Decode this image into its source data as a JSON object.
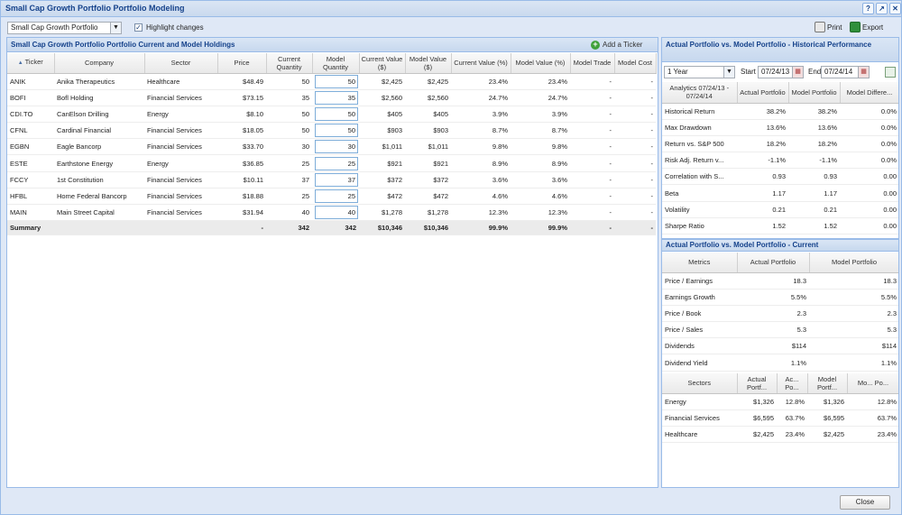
{
  "window": {
    "title": "Small Cap Growth Portfolio Portfolio Modeling"
  },
  "toolbar": {
    "portfolio_select": "Small Cap Growth Portfolio",
    "highlight_label": "Highlight changes",
    "highlight_checked": true,
    "print_label": "Print",
    "export_label": "Export"
  },
  "holdings": {
    "title": "Small Cap Growth Portfolio Portfolio Current and Model Holdings",
    "add_ticker_label": "Add a Ticker",
    "columns": [
      "Ticker",
      "Company",
      "Sector",
      "Price",
      "Current Quantity",
      "Model Quantity",
      "Current Value ($)",
      "Model Value ($)",
      "Current Value (%)",
      "Model Value (%)",
      "Model Trade",
      "Model Cost"
    ],
    "sort_indicator": "▲",
    "rows": [
      {
        "ticker": "ANIK",
        "company": "Anika Therapeutics",
        "sector": "Healthcare",
        "price": "$48.49",
        "cur_qty": "50",
        "model_qty": "50",
        "cur_val": "$2,425",
        "model_val": "$2,425",
        "cur_pct": "23.4%",
        "model_pct": "23.4%",
        "trade": "-",
        "cost": "-"
      },
      {
        "ticker": "BOFI",
        "company": "Bofl Holding",
        "sector": "Financial Services",
        "price": "$73.15",
        "cur_qty": "35",
        "model_qty": "35",
        "cur_val": "$2,560",
        "model_val": "$2,560",
        "cur_pct": "24.7%",
        "model_pct": "24.7%",
        "trade": "-",
        "cost": "-"
      },
      {
        "ticker": "CDI.TO",
        "company": "CanElson Drilling",
        "sector": "Energy",
        "price": "$8.10",
        "cur_qty": "50",
        "model_qty": "50",
        "cur_val": "$405",
        "model_val": "$405",
        "cur_pct": "3.9%",
        "model_pct": "3.9%",
        "trade": "-",
        "cost": "-"
      },
      {
        "ticker": "CFNL",
        "company": "Cardinal Financial",
        "sector": "Financial Services",
        "price": "$18.05",
        "cur_qty": "50",
        "model_qty": "50",
        "cur_val": "$903",
        "model_val": "$903",
        "cur_pct": "8.7%",
        "model_pct": "8.7%",
        "trade": "-",
        "cost": "-"
      },
      {
        "ticker": "EGBN",
        "company": "Eagle Bancorp",
        "sector": "Financial Services",
        "price": "$33.70",
        "cur_qty": "30",
        "model_qty": "30",
        "cur_val": "$1,011",
        "model_val": "$1,011",
        "cur_pct": "9.8%",
        "model_pct": "9.8%",
        "trade": "-",
        "cost": "-"
      },
      {
        "ticker": "ESTE",
        "company": "Earthstone Energy",
        "sector": "Energy",
        "price": "$36.85",
        "cur_qty": "25",
        "model_qty": "25",
        "cur_val": "$921",
        "model_val": "$921",
        "cur_pct": "8.9%",
        "model_pct": "8.9%",
        "trade": "-",
        "cost": "-"
      },
      {
        "ticker": "FCCY",
        "company": "1st Constitution",
        "sector": "Financial Services",
        "price": "$10.11",
        "cur_qty": "37",
        "model_qty": "37",
        "cur_val": "$372",
        "model_val": "$372",
        "cur_pct": "3.6%",
        "model_pct": "3.6%",
        "trade": "-",
        "cost": "-"
      },
      {
        "ticker": "HFBL",
        "company": "Home Federal Bancorp",
        "sector": "Financial Services",
        "price": "$18.88",
        "cur_qty": "25",
        "model_qty": "25",
        "cur_val": "$472",
        "model_val": "$472",
        "cur_pct": "4.6%",
        "model_pct": "4.6%",
        "trade": "-",
        "cost": "-"
      },
      {
        "ticker": "MAIN",
        "company": "Main Street Capital",
        "sector": "Financial Services",
        "price": "$31.94",
        "cur_qty": "40",
        "model_qty": "40",
        "cur_val": "$1,278",
        "model_val": "$1,278",
        "cur_pct": "12.3%",
        "model_pct": "12.3%",
        "trade": "-",
        "cost": "-"
      }
    ],
    "summary": {
      "label": "Summary",
      "price": "-",
      "cur_qty": "342",
      "model_qty": "342",
      "cur_val": "$10,346",
      "model_val": "$10,346",
      "cur_pct": "99.9%",
      "model_pct": "99.9%",
      "trade": "-",
      "cost": "-"
    }
  },
  "historical": {
    "title": "Actual Portfolio vs. Model Portfolio - Historical Performance",
    "period_select": "1 Year",
    "start_label": "Start",
    "start_value": "07/24/13",
    "end_label": "End",
    "end_value": "07/24/14",
    "columns": [
      "Analytics 07/24/13 - 07/24/14",
      "Actual Portfolio",
      "Model Portfolio",
      "Model Differe..."
    ],
    "rows": [
      {
        "metric": "Historical Return",
        "actual": "38.2%",
        "model": "38.2%",
        "diff": "0.0%"
      },
      {
        "metric": "Max Drawdown",
        "actual": "13.6%",
        "model": "13.6%",
        "diff": "0.0%"
      },
      {
        "metric": "Return vs. S&P 500",
        "actual": "18.2%",
        "model": "18.2%",
        "diff": "0.0%"
      },
      {
        "metric": "Risk Adj. Return v...",
        "actual": "-1.1%",
        "model": "-1.1%",
        "diff": "0.0%"
      },
      {
        "metric": "Correlation with S...",
        "actual": "0.93",
        "model": "0.93",
        "diff": "0.00"
      },
      {
        "metric": "Beta",
        "actual": "1.17",
        "model": "1.17",
        "diff": "0.00"
      },
      {
        "metric": "Volatility",
        "actual": "0.21",
        "model": "0.21",
        "diff": "0.00"
      },
      {
        "metric": "Sharpe Ratio",
        "actual": "1.52",
        "model": "1.52",
        "diff": "0.00"
      }
    ]
  },
  "current": {
    "title": "Actual Portfolio vs. Model Portfolio - Current",
    "columns": [
      "Metrics",
      "Actual Portfolio",
      "Model Portfolio"
    ],
    "rows": [
      {
        "metric": "Price / Earnings",
        "actual": "18.3",
        "model": "18.3"
      },
      {
        "metric": "Earnings Growth",
        "actual": "5.5%",
        "model": "5.5%"
      },
      {
        "metric": "Price / Book",
        "actual": "2.3",
        "model": "2.3"
      },
      {
        "metric": "Price / Sales",
        "actual": "5.3",
        "model": "5.3"
      },
      {
        "metric": "Dividends",
        "actual": "$114",
        "model": "$114"
      },
      {
        "metric": "Dividend Yield",
        "actual": "1.1%",
        "model": "1.1%"
      }
    ],
    "sector_columns": [
      "Sectors",
      "Actual Portf...",
      "Ac... Po...",
      "Model Portf...",
      "Mo... Po..."
    ],
    "sectors": [
      {
        "sector": "Energy",
        "actual": "$1,326",
        "actual_pct": "12.8%",
        "model": "$1,326",
        "model_pct": "12.8%"
      },
      {
        "sector": "Financial Services",
        "actual": "$6,595",
        "actual_pct": "63.7%",
        "model": "$6,595",
        "model_pct": "63.7%"
      },
      {
        "sector": "Healthcare",
        "actual": "$2,425",
        "actual_pct": "23.4%",
        "model": "$2,425",
        "model_pct": "23.4%"
      }
    ]
  },
  "footer": {
    "close_label": "Close"
  },
  "colors": {
    "accent": "#15428b",
    "border": "#99bbe8",
    "panel_bg": "#dfe8f6"
  }
}
